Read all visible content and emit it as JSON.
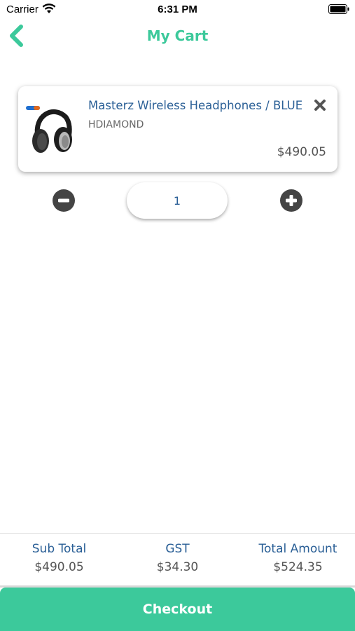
{
  "status_bar": {
    "carrier": "Carrier",
    "time": "6:31 PM",
    "icons": [
      "wifi-icon",
      "battery-icon"
    ]
  },
  "header": {
    "title": "My Cart",
    "back_icon": "chevron-left-icon"
  },
  "cart": {
    "items": [
      {
        "name": "Masterz Wireless Headphones / BLUE",
        "brand": "HDIAMOND",
        "price": "$490.05",
        "quantity": "1",
        "image_icon": "headphones-image"
      }
    ]
  },
  "summary": {
    "subtotal_label": "Sub Total",
    "subtotal_value": "$490.05",
    "gst_label": "GST",
    "gst_value": "$34.30",
    "total_label": "Total Amount",
    "total_value": "$524.35"
  },
  "checkout": {
    "label": "Checkout"
  },
  "colors": {
    "accent": "#3cc99b",
    "link_blue": "#2a5f96",
    "icon_gray": "#444444"
  }
}
